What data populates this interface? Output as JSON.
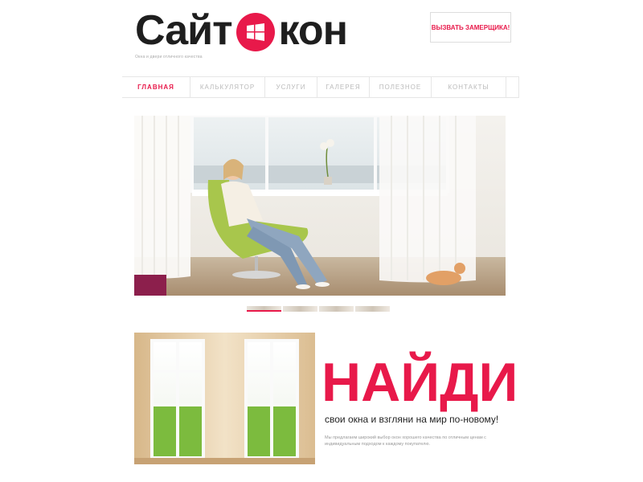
{
  "brand": {
    "name_left": "Сайт",
    "name_right": "кон",
    "tagline": "Окна и двери отличного качества",
    "accent_color": "#e8194a",
    "badge_icon": "windows-logo-icon"
  },
  "header": {
    "cta_label": "ВЫЗВАТЬ ЗАМЕРЩИКА!"
  },
  "nav": {
    "items": [
      {
        "label": "ГЛАВНАЯ",
        "active": true
      },
      {
        "label": "КАЛЬКУЛЯТОР",
        "active": false
      },
      {
        "label": "УСЛУГИ",
        "active": false
      },
      {
        "label": "ГАЛЕРЕЯ",
        "active": false
      },
      {
        "label": "ПОЛЕЗНОЕ",
        "active": false
      },
      {
        "label": "КОНТАКТЫ",
        "active": false
      }
    ]
  },
  "slider": {
    "slide_count": 4,
    "active_index": 0
  },
  "promo": {
    "title": "НАЙДИ",
    "subtitle": "свои окна и взгляни на мир по-новому!",
    "text": "Мы предлагаем широкий выбор окон хорошего качества по отличным ценам с индивидуальным подходом к каждому покупателю."
  }
}
